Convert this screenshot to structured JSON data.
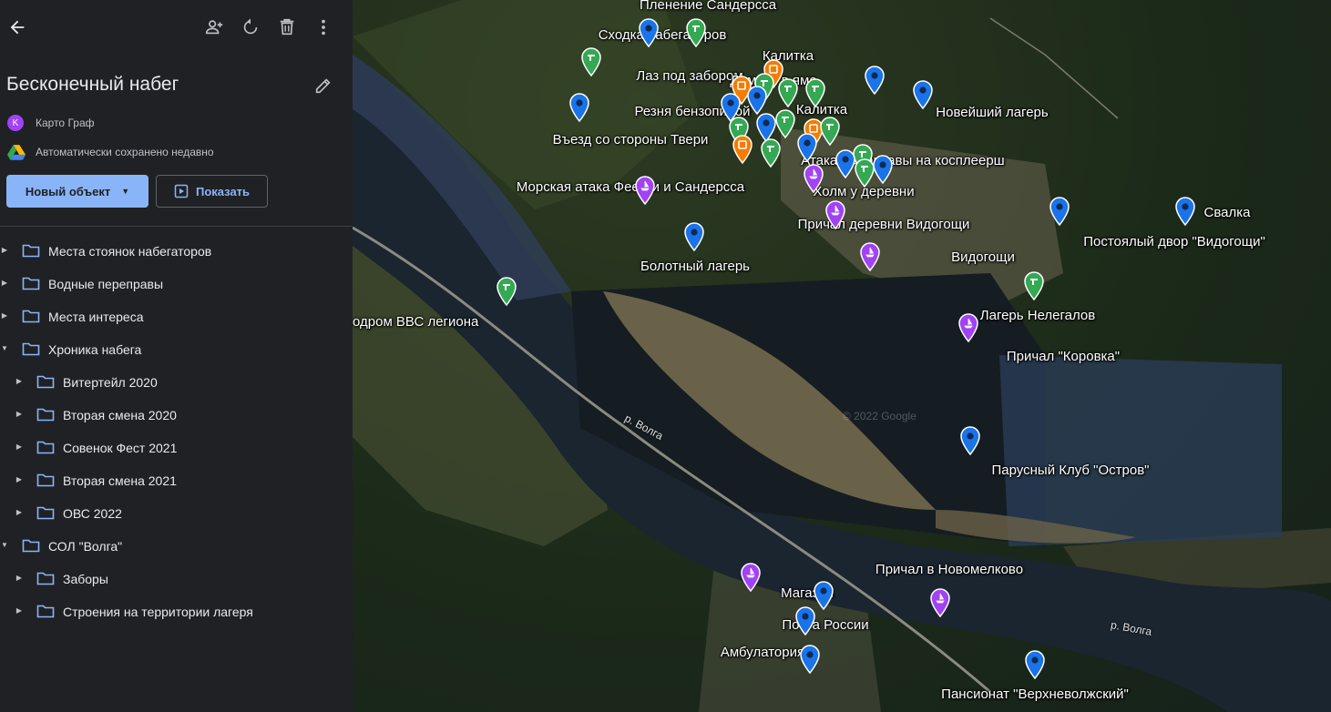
{
  "sidebar": {
    "map_title": "Бесконечный набег",
    "owner_initial": "K",
    "owner_name": "Карто Граф",
    "save_status": "Автоматически сохранено недавно",
    "new_object_label": "Новый объект",
    "show_label": "Показать",
    "tree": [
      {
        "label": "Места стоянок набегаторов",
        "level": 0,
        "expanded": false
      },
      {
        "label": "Водные переправы",
        "level": 0,
        "expanded": false
      },
      {
        "label": "Места интереса",
        "level": 0,
        "expanded": false
      },
      {
        "label": "Хроника набега",
        "level": 0,
        "expanded": true
      },
      {
        "label": "Витертейл 2020",
        "level": 1,
        "expanded": false
      },
      {
        "label": "Вторая смена 2020",
        "level": 1,
        "expanded": false
      },
      {
        "label": "Совенок Фест 2021",
        "level": 1,
        "expanded": false
      },
      {
        "label": "Вторая смена 2021",
        "level": 1,
        "expanded": false
      },
      {
        "label": "ОВС 2022",
        "level": 1,
        "expanded": false
      },
      {
        "label": "СОЛ \"Волга\"",
        "level": 0,
        "expanded": true
      },
      {
        "label": "Заборы",
        "level": 1,
        "expanded": false
      },
      {
        "label": "Строения на территории лагеря",
        "level": 1,
        "expanded": false
      }
    ]
  },
  "map": {
    "labels": [
      "Пленение Сандерсса",
      "Сходка набегаторов",
      "Калитка",
      "Лаз под забором",
      "Домики в яме",
      "Резня бензопилой",
      "Калитка",
      "Новейший лагерь",
      "Въезд со стороны Твери",
      "Атака Балаклавы на косплеерш",
      "Морская атака Феечки и Сандерсса",
      "Холм у деревни",
      "Причал деревни Видогощи",
      "Свалка",
      "Постоялый двор \"Видогощи\"",
      "Болотный лагерь",
      "Видогощи",
      "одром ВВС легиона",
      "Лагерь Нелегалов",
      "Причал \"Коровка\"",
      "Парусный Клуб \"Остров\"",
      "Причал в Новомелково",
      "Магазин",
      "Почта России",
      "Амбулатория",
      "Пансионат \"Верхневолжский\""
    ],
    "river_label": "р. Волга",
    "watermark": "© 2022 Google",
    "colors": {
      "blue_pin": "#1a73e8",
      "green_pin": "#34a853",
      "purple_pin": "#a142f4",
      "orange_pin": "#f57c00",
      "accent": "#8ab4f8"
    }
  }
}
